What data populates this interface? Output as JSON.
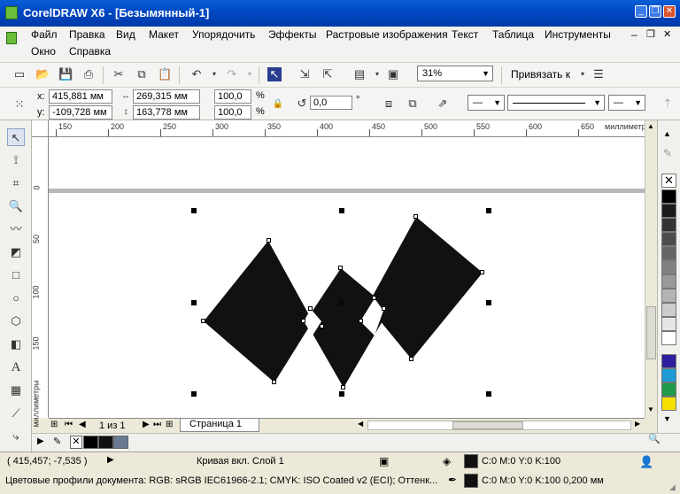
{
  "window": {
    "title": "CorelDRAW X6 - [Безымянный-1]"
  },
  "menu": {
    "row1": [
      "Файл",
      "Правка",
      "Вид",
      "Макет",
      "Упорядочить",
      "Эффекты",
      "Растровые изображения",
      "Текст",
      "Таблица",
      "Инструменты"
    ],
    "row2": [
      "Окно",
      "Справка"
    ]
  },
  "toolbar": {
    "zoom": "31%",
    "snap_label": "Привязать к"
  },
  "props": {
    "x_label": "x:",
    "x_value": "415,881 мм",
    "y_label": "y:",
    "y_value": "-109,728 мм",
    "width": "269,315 мм",
    "height": "163,778 мм",
    "scale_w": "100,0",
    "scale_h": "100,0",
    "percent": "%",
    "rotation": "0,0",
    "degree": "°"
  },
  "ruler": {
    "h_labels": [
      "150",
      "200",
      "250",
      "300",
      "350",
      "400",
      "450",
      "500",
      "550",
      "600",
      "650"
    ],
    "h_unit": "миллиметры",
    "v_labels": [
      "0",
      "50",
      "100",
      "150"
    ],
    "v_unit": "миллиметры"
  },
  "page_nav": {
    "counter": "1 из 1",
    "tab": "Страница 1"
  },
  "status": {
    "coords": "( 415,457; -7,535 )",
    "object_info": "Кривая вкл. Слой 1",
    "profiles": "Цветовые профили документа: RGB: sRGB IEC61966-2.1; CMYK: ISO Coated v2 (ECI); Оттенк...",
    "fill_info": "C:0 M:0 Y:0 K:100",
    "outline_info": "C:0 M:0 Y:0 K:100  0,200 мм"
  },
  "colors": {
    "titlebar": "#0049c5",
    "shape_fill": "#111111",
    "palette": [
      "#000000",
      "#1a1a1a",
      "#333333",
      "#4d4d4d",
      "#666666",
      "#808080",
      "#999999",
      "#b3b3b3",
      "#cccccc",
      "#e6e6e6",
      "#ffffff",
      "#2e1f9e",
      "#1e9ad6",
      "#1f9a48",
      "#f5e000"
    ]
  }
}
